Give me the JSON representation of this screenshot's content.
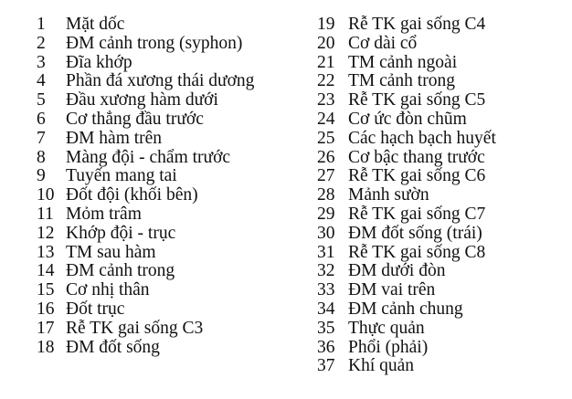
{
  "left_column": [
    {
      "n": "1",
      "label": "Mặt dốc"
    },
    {
      "n": "2",
      "label": "ĐM cảnh trong (syphon)"
    },
    {
      "n": "3",
      "label": "Đĩa khớp"
    },
    {
      "n": "4",
      "label": "Phần đá xương thái dương"
    },
    {
      "n": "5",
      "label": "Đầu xương hàm dưới"
    },
    {
      "n": "6",
      "label": "Cơ thẳng đầu trước"
    },
    {
      "n": "7",
      "label": "ĐM hàm trên"
    },
    {
      "n": "8",
      "label": "Màng đội - chẩm trước"
    },
    {
      "n": "9",
      "label": "Tuyến mang tai"
    },
    {
      "n": "10",
      "label": "Đốt đội (khối bên)"
    },
    {
      "n": "11",
      "label": "Mỏm trâm"
    },
    {
      "n": "12",
      "label": "Khớp đội - trục"
    },
    {
      "n": "13",
      "label": "TM sau hàm"
    },
    {
      "n": "14",
      "label": "ĐM cảnh trong"
    },
    {
      "n": "15",
      "label": "Cơ nhị thân"
    },
    {
      "n": "16",
      "label": "Đốt trục"
    },
    {
      "n": "17",
      "label": "Rễ TK gai sống C3"
    },
    {
      "n": "18",
      "label": "ĐM đốt sống"
    }
  ],
  "right_column": [
    {
      "n": "19",
      "label": "Rễ TK gai sống C4"
    },
    {
      "n": "20",
      "label": "Cơ dài cổ"
    },
    {
      "n": "21",
      "label": "TM cảnh ngoài"
    },
    {
      "n": "22",
      "label": "TM cảnh trong"
    },
    {
      "n": "23",
      "label": "Rễ TK gai sống C5"
    },
    {
      "n": "24",
      "label": "Cơ ức đòn chũm"
    },
    {
      "n": "25",
      "label": "Các hạch bạch huyết"
    },
    {
      "n": "26",
      "label": "Cơ bậc thang trước"
    },
    {
      "n": "27",
      "label": "Rễ TK gai sống C6"
    },
    {
      "n": "28",
      "label": "Mảnh sườn"
    },
    {
      "n": "29",
      "label": "Rễ TK gai sống C7"
    },
    {
      "n": "30",
      "label": "ĐM đốt sống (trái)"
    },
    {
      "n": "31",
      "label": "Rễ TK gai sống C8"
    },
    {
      "n": "32",
      "label": "ĐM dưới đòn"
    },
    {
      "n": "33",
      "label": "ĐM vai trên"
    },
    {
      "n": "34",
      "label": "ĐM cảnh chung"
    },
    {
      "n": "35",
      "label": "Thực quản"
    },
    {
      "n": "36",
      "label": "Phổi (phải)"
    },
    {
      "n": "37",
      "label": "Khí quản"
    }
  ]
}
